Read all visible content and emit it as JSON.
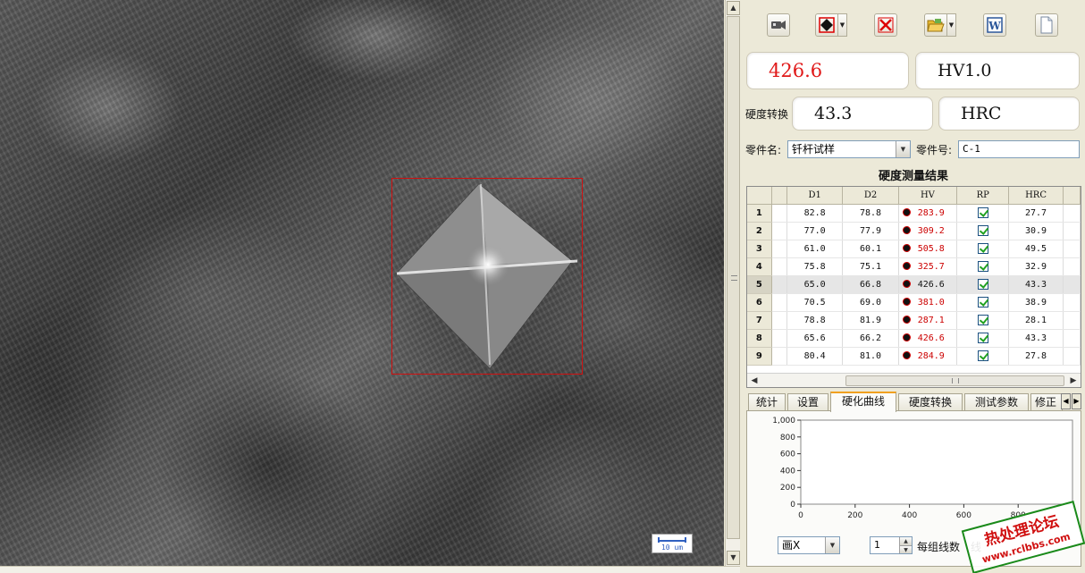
{
  "viewer": {
    "scale_label": "10 um"
  },
  "toolbar": {
    "buttons": [
      "camera-icon",
      "indent-mode-icon",
      "delete-icon",
      "open-folder-icon",
      "word-export-icon",
      "new-document-icon"
    ]
  },
  "readout": {
    "hardness_value": "426.6",
    "scale": "HV1.0",
    "conversion_label": "硬度转换",
    "converted_value": "43.3",
    "converted_scale": "HRC"
  },
  "part": {
    "name_label": "零件名:",
    "name_value": "钎杆试样",
    "number_label": "零件号:",
    "number_value": "C-1"
  },
  "results": {
    "title": "硬度测量结果",
    "columns": [
      "",
      "D1",
      "D2",
      "HV",
      "RP",
      "HRC"
    ],
    "rows": [
      {
        "no": "1",
        "d1": "82.8",
        "d2": "78.8",
        "hv": "283.9",
        "rp": true,
        "hrc": "27.7",
        "flag": true
      },
      {
        "no": "2",
        "d1": "77.0",
        "d2": "77.9",
        "hv": "309.2",
        "rp": true,
        "hrc": "30.9",
        "flag": true
      },
      {
        "no": "3",
        "d1": "61.0",
        "d2": "60.1",
        "hv": "505.8",
        "rp": true,
        "hrc": "49.5",
        "flag": true
      },
      {
        "no": "4",
        "d1": "75.8",
        "d2": "75.1",
        "hv": "325.7",
        "rp": true,
        "hrc": "32.9",
        "flag": true
      },
      {
        "no": "5",
        "d1": "65.0",
        "d2": "66.8",
        "hv": "426.6",
        "rp": true,
        "hrc": "43.3",
        "flag": false
      },
      {
        "no": "6",
        "d1": "70.5",
        "d2": "69.0",
        "hv": "381.0",
        "rp": true,
        "hrc": "38.9",
        "flag": true
      },
      {
        "no": "7",
        "d1": "78.8",
        "d2": "81.9",
        "hv": "287.1",
        "rp": true,
        "hrc": "28.1",
        "flag": true
      },
      {
        "no": "8",
        "d1": "65.6",
        "d2": "66.2",
        "hv": "426.6",
        "rp": true,
        "hrc": "43.3",
        "flag": true
      },
      {
        "no": "9",
        "d1": "80.4",
        "d2": "81.0",
        "hv": "284.9",
        "rp": true,
        "hrc": "27.8",
        "flag": true
      }
    ],
    "selected_row": 4
  },
  "tabs": [
    {
      "label": "统计",
      "active": false
    },
    {
      "label": "设置",
      "active": false
    },
    {
      "label": "硬化曲线",
      "active": true
    },
    {
      "label": "硬度转换",
      "active": false
    },
    {
      "label": "测试参数",
      "active": false
    },
    {
      "label": "修正",
      "active": false
    }
  ],
  "chart_data": {
    "type": "line",
    "series": [],
    "y_ticks": [
      "1,000",
      "800",
      "600",
      "400",
      "200",
      "0"
    ],
    "x_ticks": [
      "0",
      "200",
      "400",
      "600",
      "800"
    ],
    "ylim": [
      0,
      1000
    ],
    "xlim": [
      0,
      1000
    ]
  },
  "controls": {
    "axis_select": "画X",
    "group_count": "1",
    "group_label": "每组线数",
    "trailing_label": "线"
  },
  "watermark": {
    "line1": "热处理论坛",
    "line2": "www.rclbbs.com"
  }
}
